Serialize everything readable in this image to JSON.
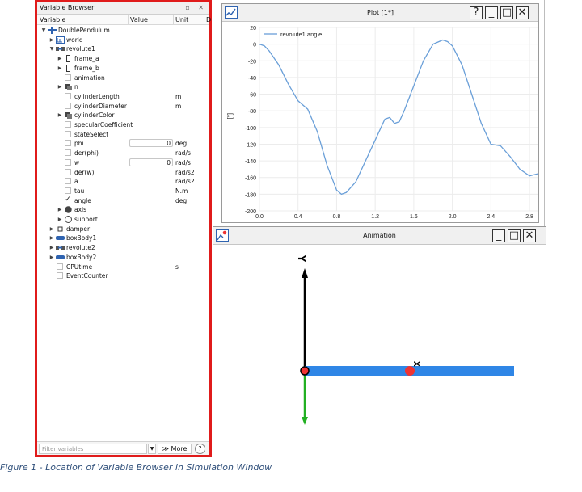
{
  "variable_browser": {
    "title": "Variable Browser",
    "title_buttons": "▫ ✕",
    "columns": {
      "variable": "Variable",
      "value": "Value",
      "unit": "Unit",
      "extra": "D"
    },
    "rows": [
      {
        "depth": 0,
        "arrow": "▼",
        "icon": "model-icon",
        "checkbox": null,
        "label": "DoublePendulum"
      },
      {
        "depth": 1,
        "arrow": "▶",
        "icon": "world-icon",
        "checkbox": null,
        "label": "world"
      },
      {
        "depth": 1,
        "arrow": "▼",
        "icon": "revolute-icon",
        "checkbox": null,
        "label": "revolute1"
      },
      {
        "depth": 2,
        "arrow": "▶",
        "icon": "frame-icon",
        "checkbox": null,
        "label": "frame_a"
      },
      {
        "depth": 2,
        "arrow": "▶",
        "icon": "frame-icon",
        "checkbox": null,
        "label": "frame_b"
      },
      {
        "depth": 2,
        "arrow": "",
        "icon": null,
        "checkbox": false,
        "label": "animation"
      },
      {
        "depth": 2,
        "arrow": "▶",
        "icon": "component-icon",
        "checkbox": null,
        "label": "n"
      },
      {
        "depth": 2,
        "arrow": "",
        "icon": null,
        "checkbox": false,
        "label": "cylinderLength",
        "unit": "m"
      },
      {
        "depth": 2,
        "arrow": "",
        "icon": null,
        "checkbox": false,
        "label": "cylinderDiameter",
        "unit": "m"
      },
      {
        "depth": 2,
        "arrow": "▶",
        "icon": "component-icon",
        "checkbox": null,
        "label": "cylinderColor"
      },
      {
        "depth": 2,
        "arrow": "",
        "icon": null,
        "checkbox": false,
        "label": "specularCoefficient"
      },
      {
        "depth": 2,
        "arrow": "",
        "icon": null,
        "checkbox": false,
        "label": "stateSelect"
      },
      {
        "depth": 2,
        "arrow": "",
        "icon": null,
        "checkbox": false,
        "label": "phi",
        "value": "0",
        "unit": "deg"
      },
      {
        "depth": 2,
        "arrow": "",
        "icon": null,
        "checkbox": false,
        "label": "der(phi)",
        "unit": "rad/s"
      },
      {
        "depth": 2,
        "arrow": "",
        "icon": null,
        "checkbox": false,
        "label": "w",
        "value": "0",
        "unit": "rad/s"
      },
      {
        "depth": 2,
        "arrow": "",
        "icon": null,
        "checkbox": false,
        "label": "der(w)",
        "unit": "rad/s2"
      },
      {
        "depth": 2,
        "arrow": "",
        "icon": null,
        "checkbox": false,
        "label": "a",
        "unit": "rad/s2"
      },
      {
        "depth": 2,
        "arrow": "",
        "icon": null,
        "checkbox": false,
        "label": "tau",
        "unit": "N.m"
      },
      {
        "depth": 2,
        "arrow": "",
        "icon": null,
        "checkbox": true,
        "label": "angle",
        "unit": "deg"
      },
      {
        "depth": 2,
        "arrow": "▶",
        "icon": "axis-icon",
        "checkbox": null,
        "label": "axis"
      },
      {
        "depth": 2,
        "arrow": "▶",
        "icon": "support-icon",
        "checkbox": null,
        "label": "support"
      },
      {
        "depth": 1,
        "arrow": "▶",
        "icon": "damper-icon",
        "checkbox": null,
        "label": "damper"
      },
      {
        "depth": 1,
        "arrow": "▶",
        "icon": "body-icon",
        "checkbox": null,
        "label": "boxBody1"
      },
      {
        "depth": 1,
        "arrow": "▶",
        "icon": "revolute-icon",
        "checkbox": null,
        "label": "revolute2"
      },
      {
        "depth": 1,
        "arrow": "▶",
        "icon": "body-icon",
        "checkbox": null,
        "label": "boxBody2"
      },
      {
        "depth": 1,
        "arrow": "",
        "icon": null,
        "checkbox": false,
        "label": "CPUtime",
        "unit": "s"
      },
      {
        "depth": 1,
        "arrow": "",
        "icon": null,
        "checkbox": false,
        "label": "EventCounter"
      }
    ],
    "filter_placeholder": "Filter variables",
    "more_label": "≫ More",
    "help_label": "?"
  },
  "plot_window": {
    "title": "Plot [1*]",
    "buttons": [
      "?",
      "_",
      "□",
      "✕"
    ],
    "chart_data": {
      "type": "line",
      "series": [
        {
          "name": "revolute1.angle",
          "color": "#6a9fd8",
          "x": [
            0,
            0.05,
            0.1,
            0.2,
            0.3,
            0.4,
            0.5,
            0.6,
            0.7,
            0.8,
            0.85,
            0.9,
            1.0,
            1.1,
            1.2,
            1.3,
            1.35,
            1.4,
            1.45,
            1.5,
            1.6,
            1.7,
            1.8,
            1.9,
            1.95,
            2.0,
            2.1,
            2.2,
            2.3,
            2.4,
            2.5,
            2.6,
            2.7,
            2.8,
            2.9
          ],
          "y": [
            0,
            -2,
            -8,
            -25,
            -48,
            -68,
            -78,
            -105,
            -145,
            -175,
            -180,
            -178,
            -165,
            -140,
            -115,
            -90,
            -88,
            -95,
            -93,
            -80,
            -50,
            -20,
            0,
            5,
            3,
            -2,
            -25,
            -60,
            -95,
            -120,
            -122,
            -135,
            -150,
            -158,
            -155
          ]
        }
      ],
      "xlim": [
        0,
        2.9
      ],
      "ylim": [
        -200,
        20
      ],
      "xticks": [
        0.0,
        0.4,
        0.8,
        1.2,
        1.6,
        2.0,
        2.4,
        2.8
      ],
      "xtick_labels": [
        "0.0",
        "0.4",
        "0.8",
        "1.2",
        "1.6",
        "2.0",
        "2.4",
        "2.8"
      ],
      "yticks": [
        20,
        0,
        -20,
        -40,
        -60,
        -80,
        -100,
        -120,
        -140,
        -160,
        -180,
        -200
      ],
      "ylabel": "[°]",
      "grid": true,
      "legend": "top-left"
    }
  },
  "animation_window": {
    "title": "Animation",
    "buttons": [
      "_",
      "□",
      "✕"
    ],
    "axis_labels": {
      "y": "Y",
      "x": "X"
    }
  },
  "caption": "Figure 1 - Location of Variable Browser in Simulation Window"
}
